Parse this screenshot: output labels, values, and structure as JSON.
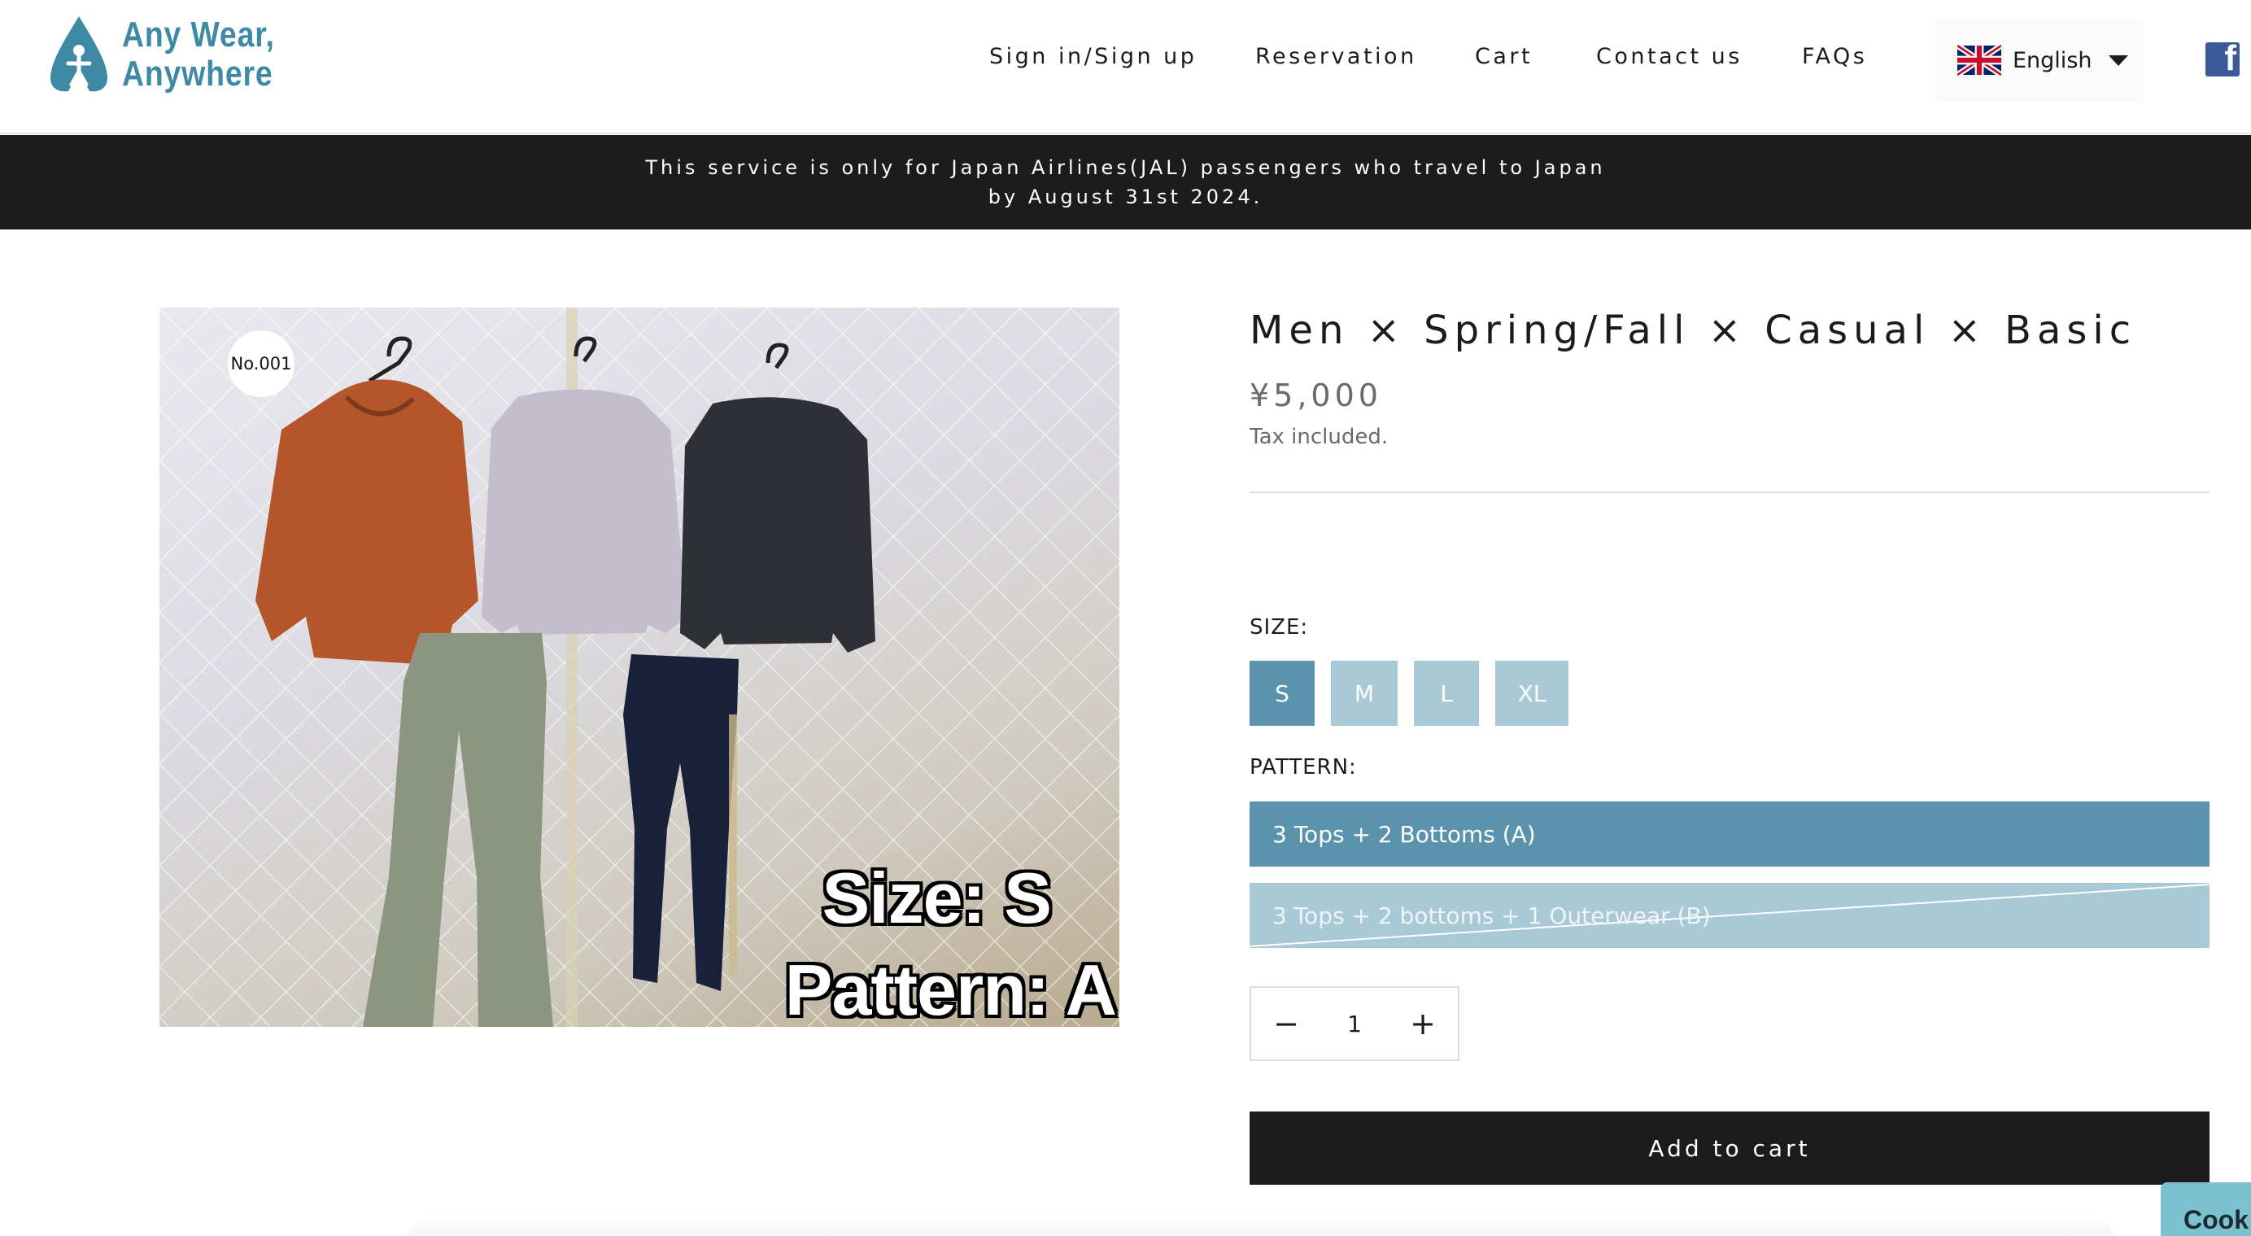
{
  "brand": {
    "name_line1": "Any Wear,",
    "name_line2": "Anywhere",
    "color": "#3e8aa5"
  },
  "nav": {
    "items": [
      {
        "label": "Sign in/Sign up"
      },
      {
        "label": "Reservation"
      },
      {
        "label": "Cart"
      },
      {
        "label": "Contact us"
      },
      {
        "label": "FAQs"
      }
    ],
    "language": {
      "label": "English",
      "flag": "uk-flag-icon"
    },
    "social": {
      "icon": "facebook-icon",
      "glyph": "f"
    }
  },
  "announcement": {
    "line1": "This service is only for Japan Airlines(JAL) passengers who travel to Japan",
    "line2": "by August 31st 2024."
  },
  "product": {
    "badge": "No.001",
    "image_caption_size": "Size: S",
    "image_caption_pattern": "Pattern: A",
    "title": "Men × Spring/Fall × Casual × Basic",
    "price": "¥5,000",
    "tax_note": "Tax included.",
    "size_label": "SIZE:",
    "sizes": [
      "S",
      "M",
      "L",
      "XL"
    ],
    "selected_size": "S",
    "pattern_label": "PATTERN:",
    "patterns": [
      {
        "label": "3 Tops + 2 Bottoms (A)",
        "state": "selected"
      },
      {
        "label": "3 Tops + 2 bottoms + 1 Outerwear (B)",
        "state": "unavailable"
      }
    ],
    "quantity": "1",
    "qty_minus": "−",
    "qty_plus": "+",
    "add_to_cart": "Add to cart"
  },
  "cookie_tab": "Cook",
  "colors": {
    "accent": "#5a93ab",
    "accent_light": "#a9c9d6",
    "dark": "#1c1c1c",
    "cookie": "#7cc1ce",
    "facebook": "#3b5998"
  }
}
